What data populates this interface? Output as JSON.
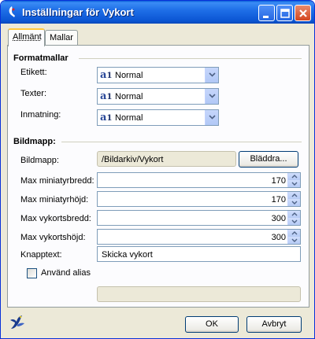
{
  "window": {
    "title": "Inställningar för Vykort",
    "buttons": {
      "minimize": "minimize-icon",
      "maximize": "maximize-icon",
      "close": "close-icon"
    }
  },
  "tabs": [
    {
      "label": "Allmänt",
      "active": true
    },
    {
      "label": "Mallar",
      "active": false
    }
  ],
  "format_section": {
    "title": "Formatmallar",
    "rows": [
      {
        "label": "Etikett:",
        "value": "Normal",
        "icon": "paragraph-style-icon"
      },
      {
        "label": "Texter:",
        "value": "Normal",
        "icon": "paragraph-style-icon"
      },
      {
        "label": "Inmatning:",
        "value": "Normal",
        "icon": "paragraph-style-icon"
      }
    ]
  },
  "image_section": {
    "title": "Bildmapp:",
    "folder": {
      "label": "Bildmapp:",
      "value": "/Bildarkiv/Vykort",
      "browse_label": "Bläddra..."
    },
    "spinners": [
      {
        "label": "Max miniatyrbredd:",
        "value": "170"
      },
      {
        "label": "Max miniatyrhöjd:",
        "value": "170"
      },
      {
        "label": "Max vykortsbredd:",
        "value": "300"
      },
      {
        "label": "Max vykortshöjd:",
        "value": "300"
      }
    ],
    "button_text": {
      "label": "Knapptext:",
      "value": "Skicka vykort"
    },
    "alias": {
      "label": "Använd alias",
      "checked": false,
      "value": ""
    }
  },
  "footer": {
    "ok_label": "OK",
    "cancel_label": "Avbryt",
    "icon": "openoffice-gull-icon"
  },
  "colors": {
    "titlebar": "#0a5fd8",
    "dialog_bg": "#ece9d8",
    "tab_highlight": "#ffc83c"
  }
}
